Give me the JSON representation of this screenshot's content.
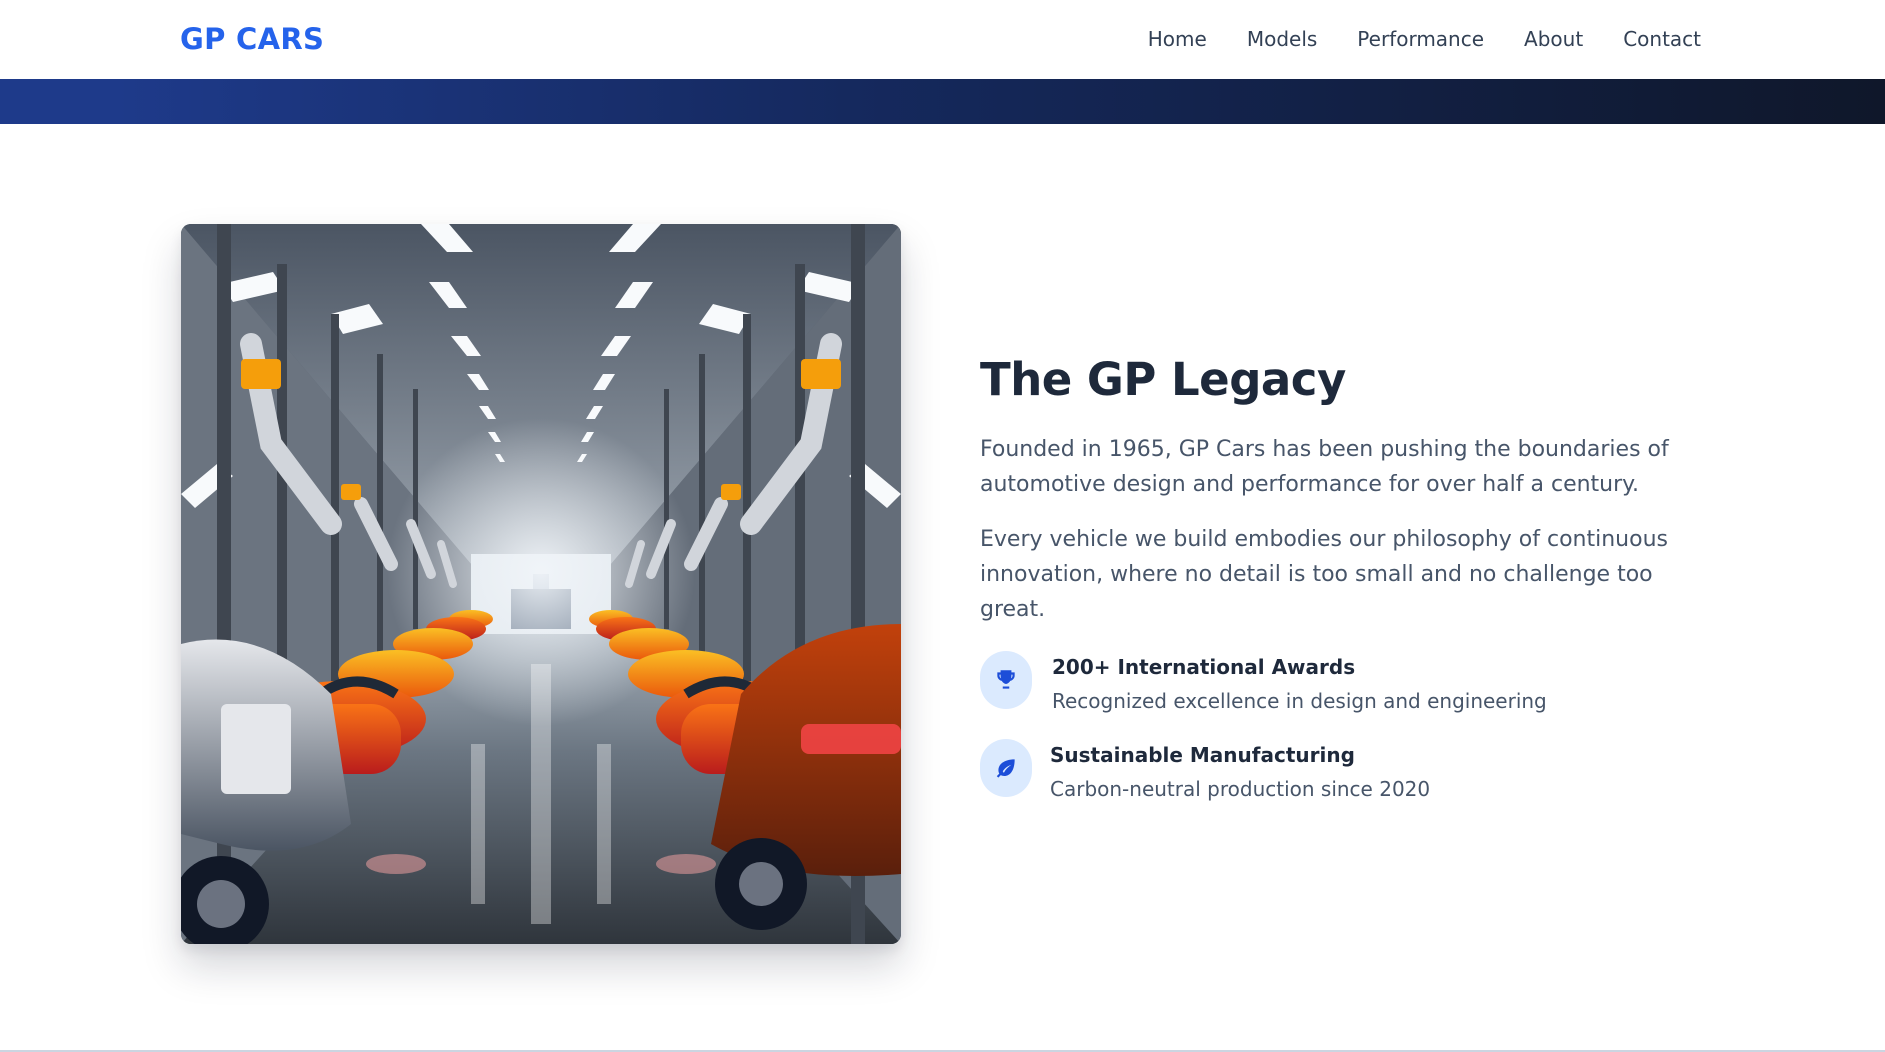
{
  "header": {
    "logo": "GP CARS",
    "nav": [
      "Home",
      "Models",
      "Performance",
      "About",
      "Contact"
    ]
  },
  "legacy": {
    "title": "The GP Legacy",
    "paragraphs": [
      "Founded in 1965, GP Cars has been pushing the boundaries of automotive design and performance for over half a century.",
      "Every vehicle we build embodies our philosophy of continuous innovation, where no detail is too small and no challenge too great."
    ],
    "features": [
      {
        "icon": "trophy-icon",
        "title": "200+ International Awards",
        "description": "Recognized excellence in design and engineering"
      },
      {
        "icon": "leaf-icon",
        "title": "Sustainable Manufacturing",
        "description": "Carbon-neutral production since 2020"
      }
    ]
  },
  "image": {
    "subject": "factory-assembly-line-photo"
  },
  "colors": {
    "brand": "#2563eb",
    "heading": "#1e293b",
    "body_text": "#475569",
    "icon_bg": "#dbeafe",
    "band_start": "#1e3a8a",
    "band_end": "#0f172a"
  }
}
